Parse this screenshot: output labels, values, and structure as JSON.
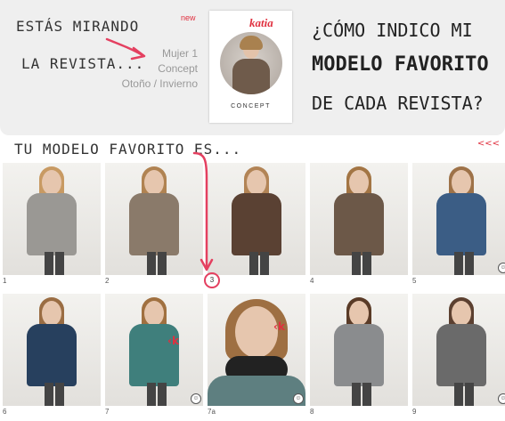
{
  "header": {
    "looking_line1": "Estás mirando",
    "looking_line2": "la revista...",
    "new_label": "new",
    "magazine_title": "Mujer 1",
    "magazine_name": "Concept",
    "magazine_season": "Otoño / Invierno",
    "cover_brand": "katia",
    "cover_title": "CONCEPT",
    "question_line1": "¿Cómo indico mi",
    "question_line2": "modelo favorito",
    "question_line3": "de cada revista?"
  },
  "subheading": "Tu modelo favorito es...",
  "prev_control": "<<<",
  "badge_icon": "face-icon",
  "accent_color": "#e0303f",
  "models": [
    {
      "number": "1",
      "colors": {
        "garment": "#9a9894",
        "inner": "#d9d4cc",
        "hair": "#c89a63"
      },
      "favorite": false,
      "badge": false,
      "k": false
    },
    {
      "number": "2",
      "colors": {
        "garment": "#8a7a6a",
        "inner": "#c2b5a5",
        "hair": "#b08352"
      },
      "favorite": false,
      "badge": false,
      "k": false
    },
    {
      "number": "3",
      "colors": {
        "garment": "#5a4133",
        "inner": "#dad6cf",
        "hair": "#b28456"
      },
      "favorite": true,
      "badge": false,
      "k": false
    },
    {
      "number": "4",
      "colors": {
        "garment": "#6c5848",
        "inner": "#6c5848",
        "hair": "#a37544"
      },
      "favorite": false,
      "badge": false,
      "k": false
    },
    {
      "number": "5",
      "colors": {
        "garment": "#3b5d85",
        "inner": "#2c4a6c",
        "hair": "#9e7248"
      },
      "favorite": false,
      "badge": true,
      "k": false
    },
    {
      "number": "6",
      "colors": {
        "garment": "#27405e",
        "inner": "#27405e",
        "hair": "#9a6d43"
      },
      "favorite": false,
      "badge": false,
      "k": false
    },
    {
      "number": "7",
      "colors": {
        "garment": "#3f7f7c",
        "inner": "#262626",
        "hair": "#a07040"
      },
      "favorite": false,
      "badge": true,
      "k": true
    },
    {
      "number": "7a",
      "colors": {
        "garment": "#5e7f80",
        "inner": "#222222",
        "hair": "#9e6f42"
      },
      "favorite": false,
      "badge": true,
      "k": true
    },
    {
      "number": "8",
      "colors": {
        "garment": "#8a8c8e",
        "inner": "#2a2a2a",
        "hair": "#5a3b27"
      },
      "favorite": false,
      "badge": false,
      "k": false
    },
    {
      "number": "9",
      "colors": {
        "garment": "#6a6a6a",
        "inner": "#3a3a3a",
        "hair": "#5c4030"
      },
      "favorite": false,
      "badge": true,
      "k": false
    }
  ]
}
